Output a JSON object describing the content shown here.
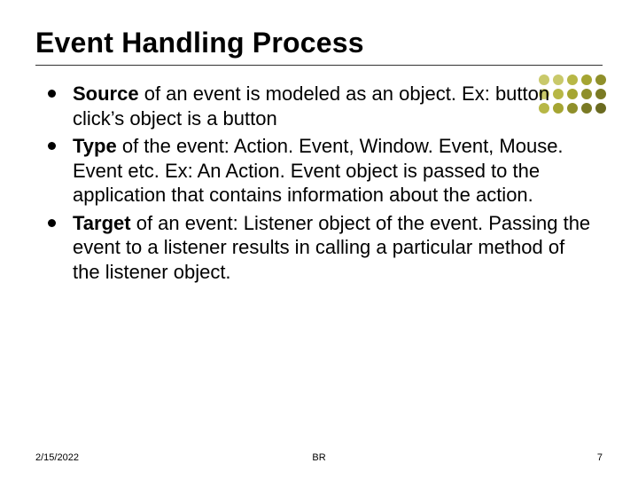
{
  "title": "Event Handling Process",
  "bullets": [
    {
      "lead": "Source",
      "rest": " of an event is modeled as an object. Ex: button click’s object is a button"
    },
    {
      "lead": "Type",
      "rest": " of the event: Action. Event, Window. Event, Mouse. Event etc. Ex: An Action. Event object is passed to the application that contains information about the action."
    },
    {
      "lead": "Target",
      "rest": " of an event: Listener object of the event. Passing the event to a listener results in  calling a particular method of the listener object."
    }
  ],
  "footer": {
    "date": "2/15/2022",
    "center": "BR",
    "page": "7"
  },
  "decoration": {
    "dot_colors": [
      "#c9c96a",
      "#c9c96a",
      "#b7b746",
      "#a5a532",
      "#8f8f2a",
      "#c9c96a",
      "#b7b746",
      "#a5a532",
      "#8f8f2a",
      "#7a7a24",
      "#b7b746",
      "#a5a532",
      "#8f8f2a",
      "#7a7a24",
      "#6a6a20"
    ]
  }
}
